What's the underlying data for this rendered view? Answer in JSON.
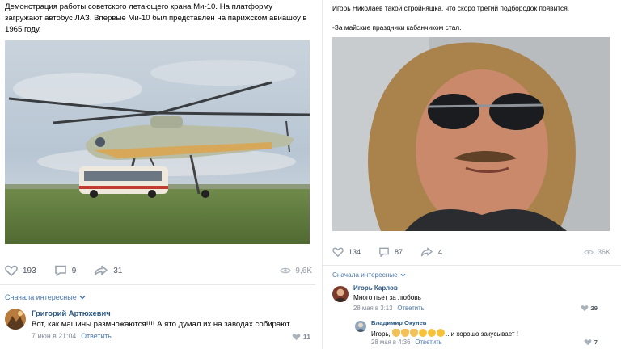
{
  "left_post": {
    "text": "Демонстрация работы советского летающего крана Ми-10. На платформу загружают автобус ЛАЗ. Впервые Ми-10 был представлен на парижском авиашоу в 1965 году.",
    "photo_icon": "helicopter-photo",
    "likes": "193",
    "comments": "9",
    "shares": "31",
    "views": "9,6K",
    "sort_label": "Сначала интересные",
    "comment": {
      "author": "Григорий Артюхевич",
      "text": "Вот, как машины размножаются!!!! А ято думал их на заводах собирают.",
      "date": "7 июн в 21:04",
      "reply": "Ответить",
      "likes": "11"
    }
  },
  "right_post": {
    "text_line1": "Игорь Николаев такой стройняшка, что скоро третий подбородок появится.",
    "text_line2": "-За майские праздники кабанчиком стал.",
    "photo_icon": "portrait-photo",
    "likes": "134",
    "comments": "87",
    "shares": "4",
    "views": "36K",
    "sort_label": "Сначала интересные",
    "comment1": {
      "author": "Игорь Карлов",
      "text": "Много пьет за любовь",
      "date": "28 мая в 3:13",
      "reply": "Ответить",
      "likes": "29"
    },
    "comment2": {
      "author": "Владимир Окунев",
      "text_prefix": "Игорь,",
      "text_suffix": "...и хорошо закусывает !",
      "date": "28 мая в 4:36",
      "reply": "Ответить",
      "likes": "7"
    }
  },
  "colors": {
    "link": "#2a5885",
    "accent": "#4a76a8",
    "meta": "#828a99",
    "icon": "#99a2ad",
    "divider": "#e7e8ec"
  }
}
